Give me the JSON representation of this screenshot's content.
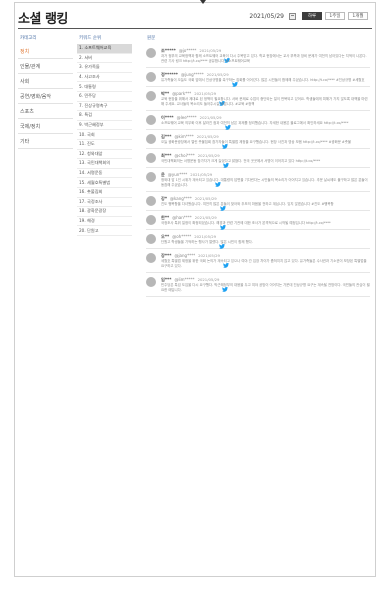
{
  "page": {
    "title": "소셜 랭킹"
  },
  "datebar": {
    "date": "2021/05/29",
    "periods": [
      {
        "label": "하루",
        "active": true
      },
      {
        "label": "1주일",
        "active": false
      },
      {
        "label": "1개월",
        "active": false
      }
    ]
  },
  "columns": {
    "category": "카테고리",
    "keyword": "키워드 순위",
    "posts": "원문"
  },
  "categories": [
    {
      "label": "정치",
      "active": true
    },
    {
      "label": "인물/관계",
      "active": false
    },
    {
      "label": "사회",
      "active": false
    },
    {
      "label": "공연/영화/음악",
      "active": false
    },
    {
      "label": "스포츠",
      "active": false
    },
    {
      "label": "국제/정치",
      "active": false
    },
    {
      "label": "기타",
      "active": false
    }
  ],
  "keywords": [
    {
      "label": "1. 소프트웨어교육",
      "active": true
    },
    {
      "label": "2. 서버",
      "active": false
    },
    {
      "label": "3. 유가족들",
      "active": false
    },
    {
      "label": "4. 사고조사",
      "active": false
    },
    {
      "label": "5. 대통령",
      "active": false
    },
    {
      "label": "6. 민주당",
      "active": false
    },
    {
      "label": "7. 진상규명촉구",
      "active": false
    },
    {
      "label": "8. 특검",
      "active": false
    },
    {
      "label": "9. 박근혜정부",
      "active": false
    },
    {
      "label": "10. 국회",
      "active": false
    },
    {
      "label": "11. 진도",
      "active": false
    },
    {
      "label": "12. 청와대앞",
      "active": false
    },
    {
      "label": "13. 국민대책회의",
      "active": false
    },
    {
      "label": "14. 서명운동",
      "active": false
    },
    {
      "label": "15. 세월호특별법",
      "active": false
    },
    {
      "label": "16. 촛불집회",
      "active": false
    },
    {
      "label": "17. 국정조사",
      "active": false
    },
    {
      "label": "18. 광화문광장",
      "active": false
    },
    {
      "label": "19. 해경",
      "active": false
    },
    {
      "label": "20. 단원고",
      "active": false
    }
  ],
  "posts": [
    {
      "user": "조*****",
      "handle": "@jo*****",
      "time": "2021/05/29",
      "text": "과거 정부의 교육정책과 함께 소프트웨어 교육이 다시 주목받고 있다. 학교 현장에서는 교사 부족과 장비 문제가 여전히 남아있다는 지적이 나온다. 관련 기사 링크 http://t.co/**** 공유합니다 #소프트웨어교육"
    },
    {
      "user": "정******",
      "handle": "@jung*****",
      "time": "2021/05/29",
      "text": "유가족들이 오늘도 국회 앞에서 진상규명을 촉구하는 집회를 이어갔다. 많은 시민들이 함께해 주셨습니다. http://t.co/**** #진상규명 #세월호"
    },
    {
      "user": "박**",
      "handle": "@park***",
      "time": "2021/05/29",
      "text": "교육 현장을 위해서 제대로 된 정책이 필요합니다. 서버 문제로 수업이 중단되는 일이 반복되고 있어요. 학생들에게 피해가 가지 않도록 대책을 마련해 주세요. 교사들의 목소리도 들어주시길 바랍니다. #교육 #정책"
    },
    {
      "user": "이****",
      "handle": "@lee*****",
      "time": "2021/05/29",
      "text": "소프트웨어 교육 의무화 이후 달라진 점과 여전히 남은 과제를 정리했습니다. 자세한 내용은 블로그에서 확인하세요 http://t.co/****"
    },
    {
      "user": "김***",
      "handle": "@kim****",
      "time": "2021/05/29",
      "text": "오늘 광화문광장에서 열린 촛불집회 참가자들이 특별법 제정을 요구했습니다. 현장 사진과 영상 모음 http://t.co/**** #광화문 #촛불"
    },
    {
      "user": "최***",
      "handle": "@choi****",
      "time": "2021/05/29",
      "text": "국민대책회의는 서명운동 참가자가 크게 늘었다고 밝혔다. 전국 곳곳에서 서명이 이어지고 있다 http://t.co/****"
    },
    {
      "user": "윤",
      "handle": "@yun****",
      "time": "2021/05/29",
      "text": "청와대 앞 1인 시위가 계속되고 있습니다. 대통령의 답변을 기다린다는 시민들의 목소리가 이어지고 있습니다. 추운 날씨에도 불구하고 많은 분들이 동참해 주셨습니다."
    },
    {
      "user": "강*",
      "handle": "@kang****",
      "time": "2021/05/29",
      "text": "진도 팽목항을 다녀왔습니다. 여전히 많은 분들이 찾아와 추모의 마음을 전하고 계십니다. 잊지 않겠습니다 #진도 #팽목항"
    },
    {
      "user": "한**",
      "handle": "@han****",
      "time": "2021/05/29",
      "text": "국정조사 특위 일정이 확정되었습니다. 해경과 관련 기관에 대한 조사가 본격적으로 시작될 예정입니다 http://t.co/****"
    },
    {
      "user": "오**",
      "handle": "@oh*****",
      "time": "2021/05/29",
      "text": "단원고 학생들을 기억하는 행사가 열렸다. 많은 시민이 함께 했다."
    },
    {
      "user": "장***",
      "handle": "@jang****",
      "time": "2021/05/29",
      "text": "세월호 특별법 제정을 위한 국회 논의가 계속되고 있으나 여야 간 입장 차이가 좁혀지지 않고 있다. 유가족들은 수사권과 기소권이 보장된 특별법을 요구하고 있다."
    },
    {
      "user": "임***",
      "handle": "@lim*****",
      "time": "2021/05/29",
      "text": "민주당은 특검 도입을 다시 요구했다. 박근혜정부의 대응을 두고 여야 공방이 이어지는 가운데 진상규명 요구는 계속될 전망이다. 국민들의 관심이 필요한 때입니다."
    }
  ]
}
